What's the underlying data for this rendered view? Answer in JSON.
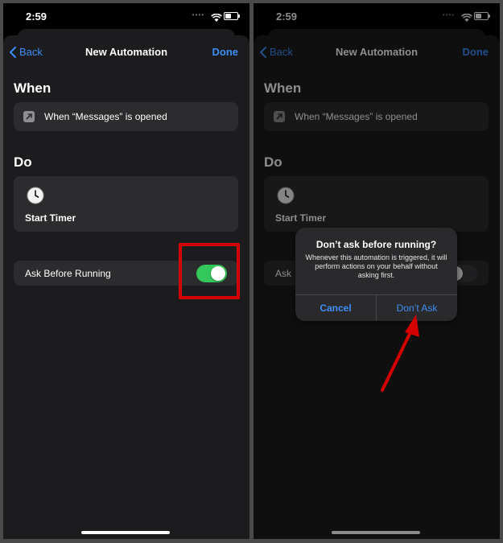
{
  "status": {
    "time": "2:59"
  },
  "nav": {
    "back_label": "Back",
    "title": "New Automation",
    "done_label": "Done"
  },
  "when": {
    "heading": "When",
    "trigger_icon": "arrow-up-right-icon",
    "trigger_text": "When “Messages” is opened"
  },
  "do": {
    "heading": "Do",
    "action_icon": "clock-icon",
    "action_label": "Start Timer"
  },
  "ask_before_running": {
    "label": "Ask Before Running",
    "label_truncated": "Ask",
    "left_state": "on",
    "right_state": "off"
  },
  "alert": {
    "title": "Don’t ask before running?",
    "message": "Whenever this automation is triggered, it will perform actions on your behalf without asking first.",
    "cancel_label": "Cancel",
    "confirm_label": "Don’t Ask"
  },
  "colors": {
    "accent": "#3e8ef7",
    "toggle_on": "#34c759",
    "annotation": "#d40000"
  }
}
